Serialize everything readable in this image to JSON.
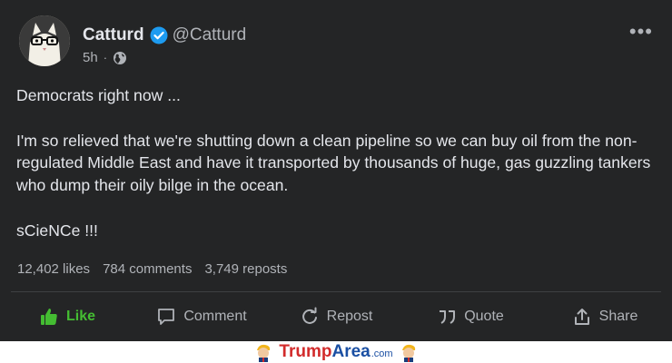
{
  "post": {
    "author_name": "Catturd",
    "handle": "@Catturd",
    "time": "5h",
    "more": "•••",
    "body": [
      "Democrats right now ...",
      "I'm so relieved that we're shutting down a clean pipeline so we can buy oil from the non-regulated Middle East and have it transported by thousands of huge, gas guzzling tankers who dump their oily bilge in the ocean.",
      "sCieNCe !!!"
    ],
    "stats": {
      "likes": "12,402 likes",
      "comments": "784 comments",
      "reposts": "3,749 reposts"
    },
    "actions": {
      "like": "Like",
      "comment": "Comment",
      "repost": "Repost",
      "quote": "Quote",
      "share": "Share"
    }
  },
  "footer": {
    "brand_trump": "Trump",
    "brand_area": "Area",
    "brand_com": ".com"
  },
  "colors": {
    "card_bg": "#242526",
    "text": "#e4e6eb",
    "muted": "#b0b3b8",
    "like_green": "#44bd32",
    "verified_blue": "#1d9bf0",
    "brand_red": "#d22b2b",
    "brand_blue": "#1a4fa3"
  },
  "icons": [
    "verified-badge-icon",
    "globe-icon",
    "more-options-icon",
    "thumbs-up-icon",
    "comment-icon",
    "repost-icon",
    "quote-icon",
    "share-icon",
    "trump-mascot-icon"
  ]
}
